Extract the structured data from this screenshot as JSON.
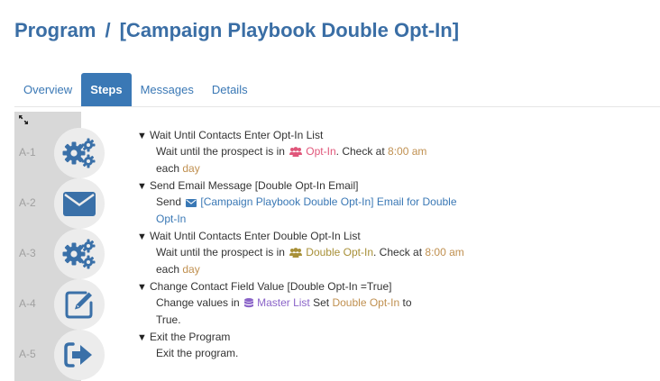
{
  "header": {
    "crumb_root": "Program",
    "separator": "/",
    "crumb_current": "[Campaign Playbook Double Opt-In]"
  },
  "tabs": [
    {
      "label": "Overview",
      "active": false
    },
    {
      "label": "Steps",
      "active": true
    },
    {
      "label": "Messages",
      "active": false
    },
    {
      "label": "Details",
      "active": false
    }
  ],
  "colors": {
    "accent": "#3a78b5",
    "title": "#3a6ea5",
    "time": "#c09050",
    "opt_in_list": "#e0567a",
    "double_opt_in_list": "#a89038",
    "master_list": "#8a63c8"
  },
  "steps": [
    {
      "id": "A-1",
      "icon": "gears-icon",
      "title": "Wait Until Contacts Enter Opt-In List",
      "desc_prefix": "Wait until the prospect is in",
      "list_icon": "users-icon",
      "list_name": "Opt-In",
      "desc_mid": ". Check at",
      "time": "8:00 am",
      "desc_each": "each",
      "period": "day"
    },
    {
      "id": "A-2",
      "icon": "envelope-icon",
      "title": "Send Email Message [Double Opt-In Email]",
      "desc_prefix": "Send",
      "message_icon": "envelope-icon",
      "message_name": "[Campaign Playbook Double Opt-In] Email for Double Opt-In"
    },
    {
      "id": "A-3",
      "icon": "gears-icon",
      "title": "Wait Until Contacts Enter Double Opt-In List",
      "desc_prefix": "Wait until the prospect is in",
      "list_icon": "users-icon",
      "list_name": "Double Opt-In",
      "desc_mid": ". Check at",
      "time": "8:00 am",
      "desc_each": "each",
      "period": "day"
    },
    {
      "id": "A-4",
      "icon": "edit-icon",
      "title": "Change Contact Field Value [Double Opt-In =True]",
      "desc_prefix": "Change values in",
      "list_icon": "database-icon",
      "list_name": "Master List",
      "desc_set": "Set",
      "field_name": "Double Opt-In",
      "desc_to": "to",
      "value": "True."
    },
    {
      "id": "A-5",
      "icon": "exit-icon",
      "title": "Exit the Program",
      "desc": "Exit the program."
    }
  ]
}
